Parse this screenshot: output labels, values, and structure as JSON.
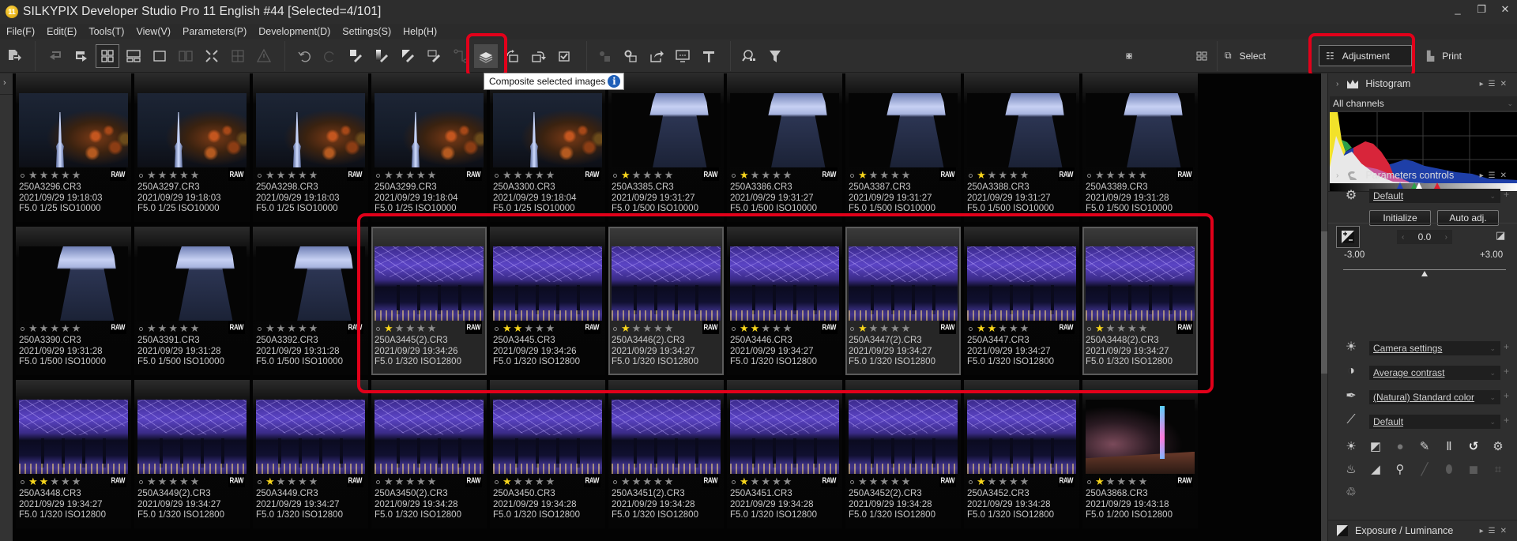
{
  "window": {
    "app_badge": "11",
    "title": "SILKYPIX Developer Studio Pro 11 English   #44   [Selected=4/101]",
    "controls": [
      "_",
      "❐",
      "✕"
    ]
  },
  "menu": [
    "File(F)",
    "Edit(E)",
    "Tools(T)",
    "View(V)",
    "Parameters(P)",
    "Development(D)",
    "Settings(S)",
    "Help(H)"
  ],
  "toolbar": {
    "tooltip": "Composite selected images",
    "tooltip_info": "i",
    "highlighted_button": "composite-selected-images",
    "buttons": [
      "export",
      "rotate-left-frame",
      "rotate-right-frame",
      "thumbnail-grid-view",
      "preview-thumbnail-view",
      "single-preview-view",
      "compare-view",
      "fullscreen",
      "loupe",
      "warning",
      "undo",
      "redo",
      "paste-exposure",
      "paste-tone",
      "paste-color",
      "paste-film",
      "link",
      "composite-selected-images",
      "rotate-left",
      "rotate-right",
      "check",
      "batch-develop",
      "develop-settings",
      "share",
      "display",
      "hammer",
      "find",
      "filter"
    ],
    "size_small_icon": "small-thumb-size",
    "size_large_icon": "large-thumb-size",
    "modes": {
      "select": "Select",
      "adjustment": "Adjustment",
      "print": "Print"
    }
  },
  "accent_colors": {
    "highlight_box": "#e2001a",
    "star_on": "#f7d51c",
    "star_off": "#8c8c8c"
  },
  "thumbnails": [
    {
      "file": "250A3296.CR3",
      "date": "2021/09/29 19:18:03",
      "exposure": "F5.0 1/25 ISO10000",
      "stars": 0,
      "art": "tree",
      "selected": false
    },
    {
      "file": "250A3297.CR3",
      "date": "2021/09/29 19:18:03",
      "exposure": "F5.0 1/25 ISO10000",
      "stars": 0,
      "art": "tree",
      "selected": false
    },
    {
      "file": "250A3298.CR3",
      "date": "2021/09/29 19:18:03",
      "exposure": "F5.0 1/25 ISO10000",
      "stars": 0,
      "art": "tree",
      "selected": false
    },
    {
      "file": "250A3299.CR3",
      "date": "2021/09/29 19:18:04",
      "exposure": "F5.0 1/25 ISO10000",
      "stars": 0,
      "art": "tree",
      "selected": false
    },
    {
      "file": "250A3300.CR3",
      "date": "2021/09/29 19:18:04",
      "exposure": "F5.0 1/25 ISO10000",
      "stars": 0,
      "art": "tree",
      "selected": false
    },
    {
      "file": "250A3385.CR3",
      "date": "2021/09/29 19:31:27",
      "exposure": "F5.0 1/500 ISO10000",
      "stars": 1,
      "art": "deck",
      "selected": false
    },
    {
      "file": "250A3386.CR3",
      "date": "2021/09/29 19:31:27",
      "exposure": "F5.0 1/500 ISO10000",
      "stars": 1,
      "art": "deck",
      "selected": false
    },
    {
      "file": "250A3387.CR3",
      "date": "2021/09/29 19:31:27",
      "exposure": "F5.0 1/500 ISO10000",
      "stars": 1,
      "art": "deck",
      "selected": false
    },
    {
      "file": "250A3388.CR3",
      "date": "2021/09/29 19:31:27",
      "exposure": "F5.0 1/500 ISO10000",
      "stars": 1,
      "art": "deck",
      "selected": false
    },
    {
      "file": "250A3389.CR3",
      "date": "2021/09/29 19:31:28",
      "exposure": "F5.0 1/500 ISO10000",
      "stars": 0,
      "art": "deck",
      "selected": false
    },
    {
      "file": "250A3390.CR3",
      "date": "2021/09/29 19:31:28",
      "exposure": "F5.0 1/500 ISO10000",
      "stars": 0,
      "art": "deck",
      "selected": false
    },
    {
      "file": "250A3391.CR3",
      "date": "2021/09/29 19:31:28",
      "exposure": "F5.0 1/500 ISO10000",
      "stars": 0,
      "art": "deck",
      "selected": false
    },
    {
      "file": "250A3392.CR3",
      "date": "2021/09/29 19:31:28",
      "exposure": "F5.0 1/500 ISO10000",
      "stars": 0,
      "art": "deck",
      "selected": false
    },
    {
      "file": "250A3445(2).CR3",
      "date": "2021/09/29 19:34:26",
      "exposure": "F5.0 1/320 ISO12800",
      "stars": 1,
      "art": "dome",
      "selected": true
    },
    {
      "file": "250A3445.CR3",
      "date": "2021/09/29 19:34:26",
      "exposure": "F5.0 1/320 ISO12800",
      "stars": 2,
      "art": "dome",
      "selected": false
    },
    {
      "file": "250A3446(2).CR3",
      "date": "2021/09/29 19:34:27",
      "exposure": "F5.0 1/320 ISO12800",
      "stars": 1,
      "art": "dome",
      "selected": true
    },
    {
      "file": "250A3446.CR3",
      "date": "2021/09/29 19:34:27",
      "exposure": "F5.0 1/320 ISO12800",
      "stars": 2,
      "art": "dome",
      "selected": false
    },
    {
      "file": "250A3447(2).CR3",
      "date": "2021/09/29 19:34:27",
      "exposure": "F5.0 1/320 ISO12800",
      "stars": 1,
      "art": "dome",
      "selected": true
    },
    {
      "file": "250A3447.CR3",
      "date": "2021/09/29 19:34:27",
      "exposure": "F5.0 1/320 ISO12800",
      "stars": 2,
      "art": "dome",
      "selected": false
    },
    {
      "file": "250A3448(2).CR3",
      "date": "2021/09/29 19:34:27",
      "exposure": "F5.0 1/320 ISO12800",
      "stars": 1,
      "art": "dome",
      "selected": true
    },
    {
      "file": "250A3448.CR3",
      "date": "2021/09/29 19:34:27",
      "exposure": "F5.0 1/320 ISO12800",
      "stars": 2,
      "art": "dome",
      "selected": false
    },
    {
      "file": "250A3449(2).CR3",
      "date": "2021/09/29 19:34:27",
      "exposure": "F5.0 1/320 ISO12800",
      "stars": 0,
      "art": "dome",
      "selected": false
    },
    {
      "file": "250A3449.CR3",
      "date": "2021/09/29 19:34:27",
      "exposure": "F5.0 1/320 ISO12800",
      "stars": 1,
      "art": "dome",
      "selected": false
    },
    {
      "file": "250A3450(2).CR3",
      "date": "2021/09/29 19:34:28",
      "exposure": "F5.0 1/320 ISO12800",
      "stars": 0,
      "art": "dome",
      "selected": false
    },
    {
      "file": "250A3450.CR3",
      "date": "2021/09/29 19:34:28",
      "exposure": "F5.0 1/320 ISO12800",
      "stars": 1,
      "art": "dome",
      "selected": false
    },
    {
      "file": "250A3451(2).CR3",
      "date": "2021/09/29 19:34:28",
      "exposure": "F5.0 1/320 ISO12800",
      "stars": 0,
      "art": "dome",
      "selected": false
    },
    {
      "file": "250A3451.CR3",
      "date": "2021/09/29 19:34:28",
      "exposure": "F5.0 1/320 ISO12800",
      "stars": 1,
      "art": "dome",
      "selected": false
    },
    {
      "file": "250A3452(2).CR3",
      "date": "2021/09/29 19:34:28",
      "exposure": "F5.0 1/320 ISO12800",
      "stars": 0,
      "art": "dome",
      "selected": false
    },
    {
      "file": "250A3452.CR3",
      "date": "2021/09/29 19:34:28",
      "exposure": "F5.0 1/320 ISO12800",
      "stars": 1,
      "art": "dome",
      "selected": false
    },
    {
      "file": "250A3868.CR3",
      "date": "2021/09/29 19:43:18",
      "exposure": "F5.0 1/200 ISO12800",
      "stars": 1,
      "art": "night",
      "selected": false
    }
  ],
  "thumb_badge": "RAW",
  "right_panel": {
    "histogram": {
      "title": "Histogram",
      "channel": "All channels"
    },
    "parameters": {
      "title": "Parameters controls",
      "preset": "Default",
      "initialize": "Initialize",
      "auto_adj": "Auto adj.",
      "exposure_value": "0.0",
      "exposure_min": "-3.00",
      "exposure_max": "+3.00",
      "exposure_fraction": 0.5,
      "white_balance": "Camera settings",
      "tone": "Average contrast",
      "color": "(Natural) Standard color",
      "sharpness": "Default"
    },
    "exposure_section": {
      "title": "Exposure / Luminance"
    }
  }
}
